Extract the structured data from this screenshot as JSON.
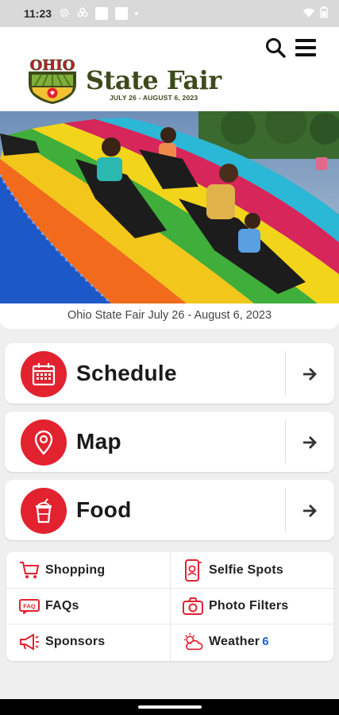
{
  "status_bar": {
    "time": "11:23"
  },
  "header": {
    "logo_mark": "OHIO",
    "logo_title": "State Fair",
    "logo_dates": "JULY 26 - AUGUST 6, 2023"
  },
  "hero": {
    "caption": "Ohio State Fair July 26 - August 6, 2023"
  },
  "cards": [
    {
      "label": "Schedule",
      "icon": "calendar-icon"
    },
    {
      "label": "Map",
      "icon": "map-pin-icon"
    },
    {
      "label": "Food",
      "icon": "drink-cup-icon"
    }
  ],
  "quick_links": {
    "shopping": {
      "label": "Shopping",
      "icon": "cart-icon"
    },
    "selfie": {
      "label": "Selfie Spots",
      "icon": "phone-camera-icon"
    },
    "faqs": {
      "label": "FAQs",
      "icon": "faq-icon"
    },
    "filters": {
      "label": "Photo Filters",
      "icon": "camera-icon"
    },
    "sponsors": {
      "label": "Sponsors",
      "icon": "megaphone-icon"
    },
    "weather": {
      "label": "Weather",
      "icon": "weather-icon",
      "badge": "6"
    }
  },
  "colors": {
    "accent_red": "#e2222f",
    "brand_green": "#3d4a1c",
    "background": "#efefef"
  }
}
